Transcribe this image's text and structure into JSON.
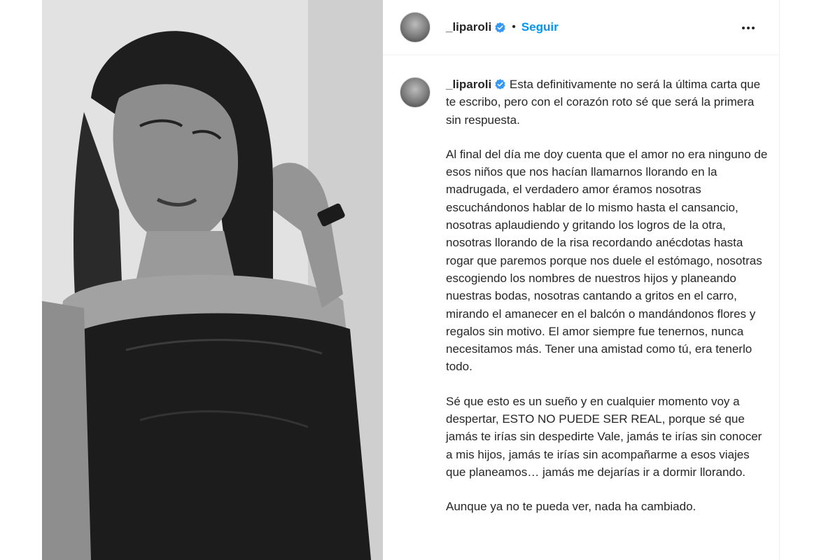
{
  "post": {
    "username": "_liparoli",
    "follow_label": "Seguir",
    "separator": "•",
    "icons": {
      "verified": "verified-badge-icon",
      "more": "more-options-icon",
      "carousel": "chevron-right-icon"
    },
    "colors": {
      "accent": "#0095f6",
      "text": "#262626",
      "border": "#efefef"
    }
  },
  "caption": {
    "p1": "Esta definitivamente no será la última carta que te escribo, pero con el corazón roto sé que será la primera sin respuesta.",
    "p2": "Al final del día me doy cuenta que el amor no era ninguno de esos niños que nos hacían llamarnos llorando en la madrugada, el verdadero amor éramos nosotras escuchándonos hablar de lo mismo hasta el cansancio, nosotras aplaudiendo y gritando los logros de la otra, nosotras llorando de la risa recordando anécdotas hasta rogar que paremos porque nos duele el estómago, nosotras escogiendo los nombres de nuestros hijos y planeando nuestras bodas, nosotras cantando a gritos en el carro, mirando el amanecer en el balcón o mandándonos flores y regalos sin motivo. El amor siempre fue tenernos, nunca necesitamos más. Tener una amistad como tú, era tenerlo todo.",
    "p3": "Sé que esto es un sueño y en cualquier momento voy a despertar, ESTO NO PUEDE SER REAL, porque sé que jamás te irías sin despedirte Vale, jamás te irías sin conocer a mis hijos, jamás te irías sin acompañarme a esos viajes que planeamos… jamás me dejarías ir a dormir llorando.",
    "p4": "Aunque ya no te pueda ver, nada ha cambiado."
  }
}
